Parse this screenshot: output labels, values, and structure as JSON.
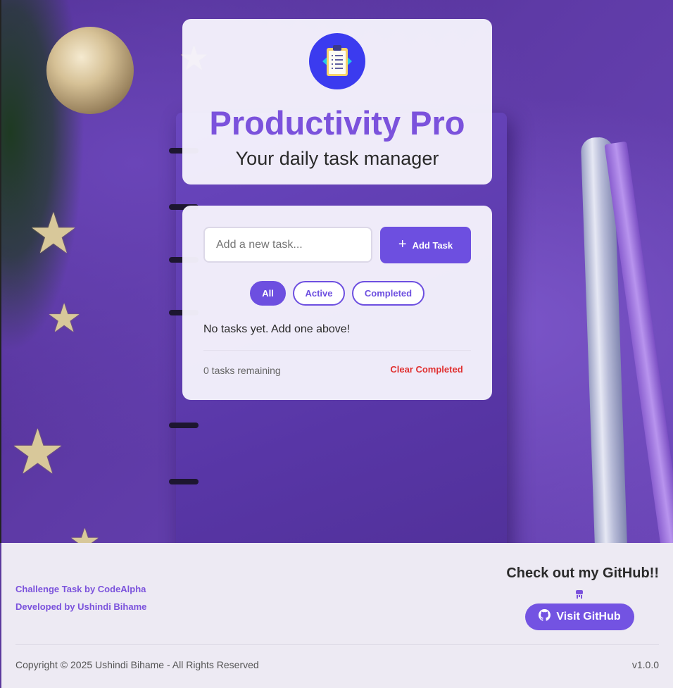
{
  "header": {
    "logo_icon": "clipboard-checklist-icon",
    "title": "Productivity Pro",
    "subtitle": "Your daily task manager"
  },
  "task_form": {
    "input_placeholder": "Add a new task...",
    "input_value": "",
    "add_button_icon": "plus-icon",
    "add_button_label": "Add Task"
  },
  "filters": [
    {
      "label": "All",
      "active": true
    },
    {
      "label": "Active",
      "active": false
    },
    {
      "label": "Completed",
      "active": false
    }
  ],
  "task_list": {
    "empty_message": "No tasks yet. Add one above!"
  },
  "summary": {
    "remaining": "0 tasks remaining",
    "clear_label": "Clear Completed"
  },
  "footer": {
    "credit_1": "Challenge Task by CodeAlpha",
    "credit_2": "Developed by Ushindi Bihame",
    "github_heading": "Check out my GitHub!!",
    "github_mini_icon": "broken-image-icon",
    "github_button_icon": "github-icon",
    "github_button_label": "Visit GitHub",
    "copyright": "Copyright © 2025 Ushindi Bihame - All Rights Reserved",
    "version": "v1.0.0"
  },
  "colors": {
    "accent": "#6d4fe0",
    "title": "#7b52dc",
    "danger": "#e03131",
    "logo_bg": "#3b3bef"
  }
}
